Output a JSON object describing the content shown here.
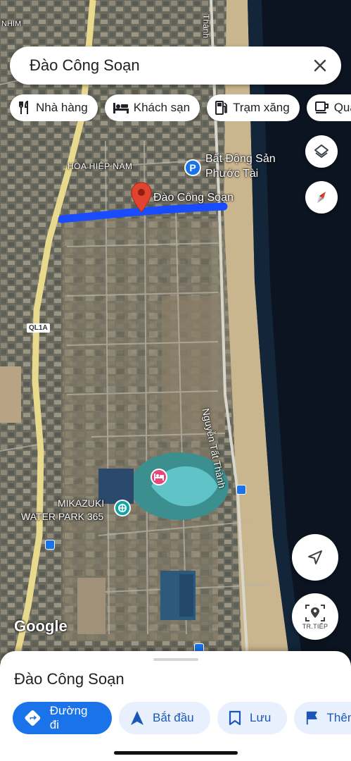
{
  "search": {
    "query": "Đào Công Soạn"
  },
  "chips": [
    {
      "label": "Nhà hàng",
      "icon": "restaurant-icon"
    },
    {
      "label": "Khách sạn",
      "icon": "hotel-icon"
    },
    {
      "label": "Trạm xăng",
      "icon": "gas-station-icon"
    },
    {
      "label": "Quá",
      "icon": "coffee-icon"
    }
  ],
  "map": {
    "labels": {
      "top_left": "NHIM",
      "top_right": "Thành",
      "district": "HÒA HIỆP NAM",
      "poi_realestate_line1": "Bất Động Sản",
      "poi_realestate_line2": "Phước Tài",
      "street": "Đào Công Soạn",
      "road_right": "Nguyễn Tất Thành",
      "highway_shield": "QL1A",
      "waterpark_line1": "MIKAZUKI",
      "waterpark_line2": "WATER PARK 365",
      "attribution": "Google"
    },
    "colors": {
      "route": "#1a4cff",
      "pin": "#e0442f",
      "ocean": "#0b1420",
      "beach": "#c9b58e"
    }
  },
  "fabs": {
    "live_label": "TR.TIẾP"
  },
  "sheet": {
    "title": "Đào Công Soạn",
    "actions": [
      {
        "label": "Đường đi",
        "icon": "directions-icon",
        "primary": true
      },
      {
        "label": "Bắt đầu",
        "icon": "navigation-arrow-icon"
      },
      {
        "label": "Lưu",
        "icon": "bookmark-icon"
      },
      {
        "label": "Thêm",
        "icon": "flag-icon"
      }
    ]
  }
}
